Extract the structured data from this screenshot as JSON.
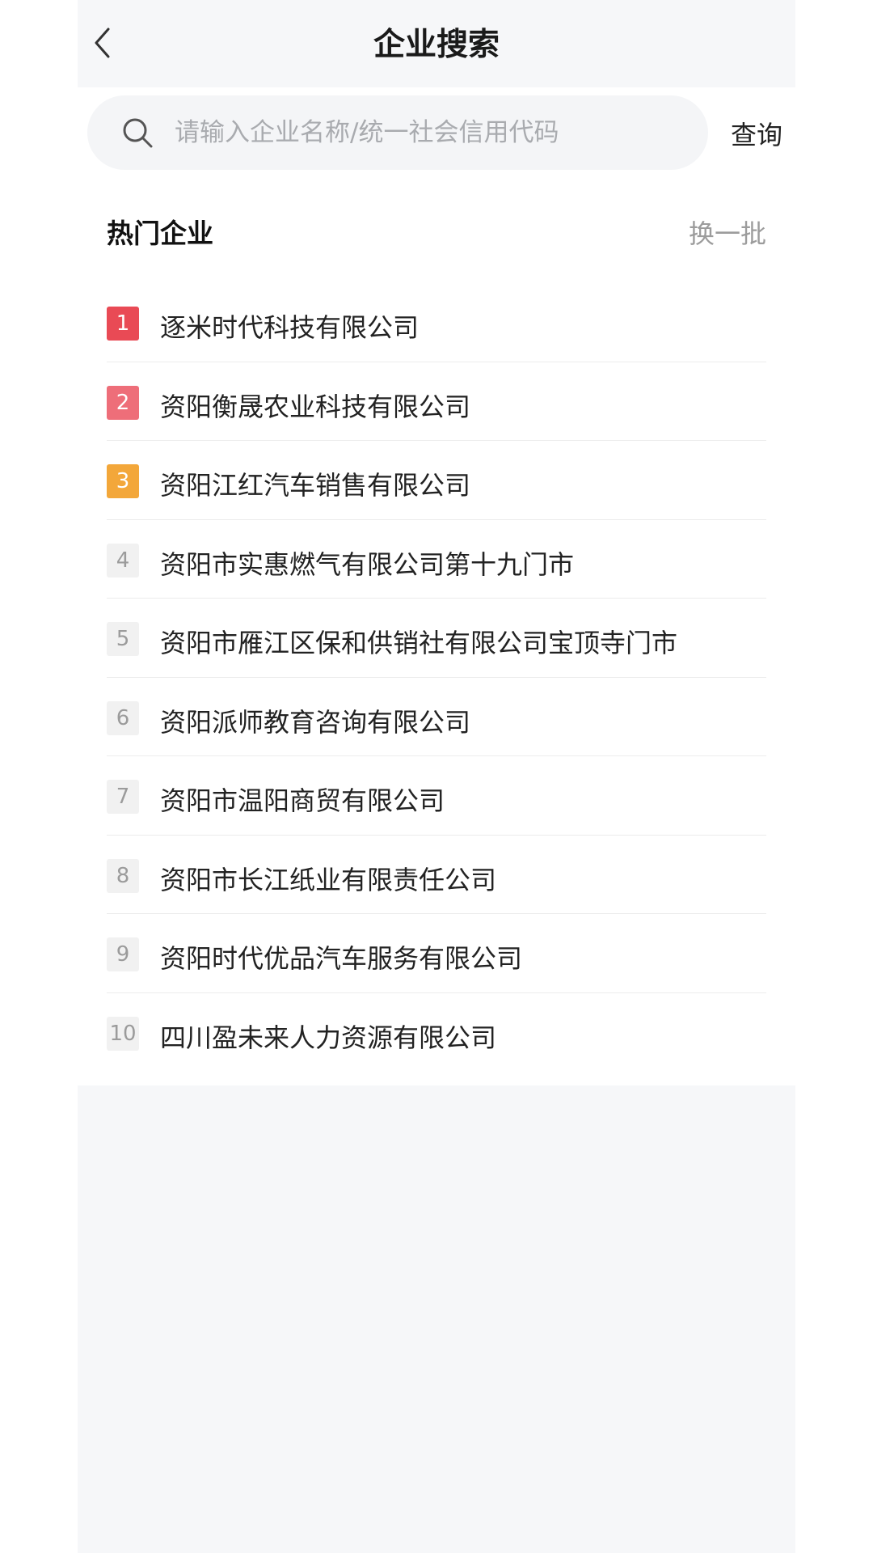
{
  "header": {
    "title": "企业搜索",
    "back_icon": "chevron-left-icon"
  },
  "search": {
    "placeholder": "请输入企业名称/统一社会信用代码",
    "value": "",
    "button_label": "查询",
    "icon": "search-icon"
  },
  "hot": {
    "title": "热门企业",
    "refresh_label": "换一批",
    "rank_colors": {
      "1": "#e94a55",
      "2": "#ee6e79",
      "3": "#f3a73a",
      "other": "#f1f1f1"
    },
    "items": [
      {
        "rank": "1",
        "name": "逐米时代科技有限公司"
      },
      {
        "rank": "2",
        "name": "资阳衡晟农业科技有限公司"
      },
      {
        "rank": "3",
        "name": "资阳江红汽车销售有限公司"
      },
      {
        "rank": "4",
        "name": "资阳市实惠燃气有限公司第十九门市"
      },
      {
        "rank": "5",
        "name": "资阳市雁江区保和供销社有限公司宝顶寺门市"
      },
      {
        "rank": "6",
        "name": "资阳派师教育咨询有限公司"
      },
      {
        "rank": "7",
        "name": "资阳市温阳商贸有限公司"
      },
      {
        "rank": "8",
        "name": "资阳市长江纸业有限责任公司"
      },
      {
        "rank": "9",
        "name": "资阳时代优品汽车服务有限公司"
      },
      {
        "rank": "10",
        "name": "四川盈未来人力资源有限公司"
      }
    ]
  }
}
